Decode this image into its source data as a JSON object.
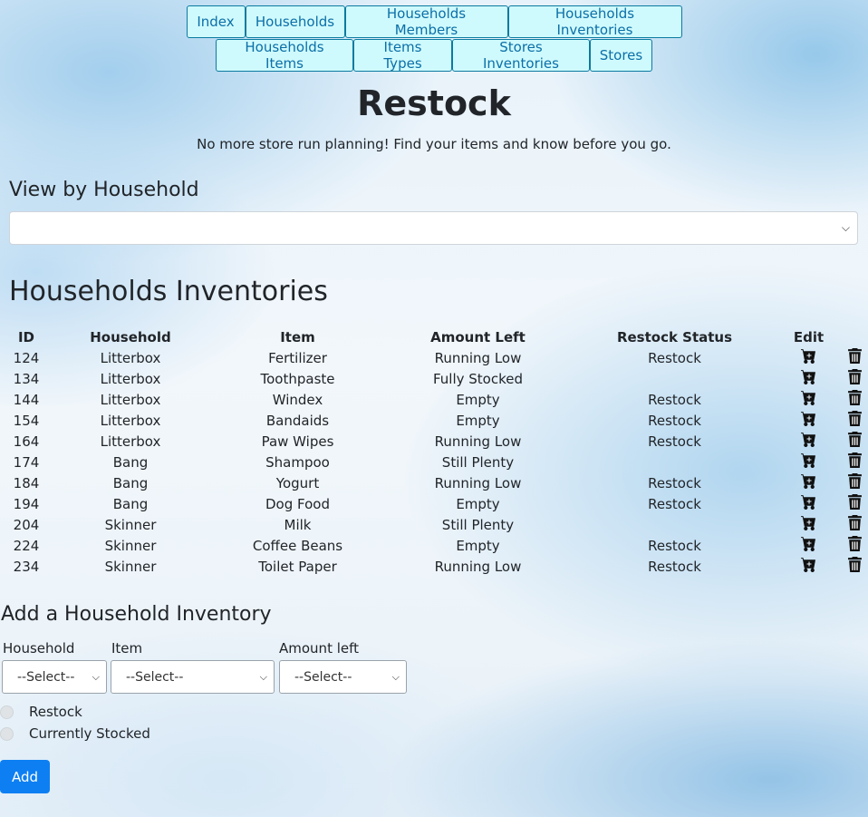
{
  "nav": {
    "row1": [
      "Index",
      "Households",
      "Households Members",
      "Households Inventories"
    ],
    "row2": [
      "Households Items",
      "Items Types",
      "Stores Inventories",
      "Stores"
    ]
  },
  "header": {
    "title": "Restock",
    "subtitle": "No more store run planning! Find your items and know before you go."
  },
  "view": {
    "label": "View by Household",
    "selected": ""
  },
  "inventory": {
    "heading": "Households Inventories",
    "columns": [
      "ID",
      "Household",
      "Item",
      "Amount Left",
      "Restock Status",
      "Edit"
    ],
    "rows": [
      [
        "124",
        "Litterbox",
        "Fertilizer",
        "Running Low",
        "Restock"
      ],
      [
        "134",
        "Litterbox",
        "Toothpaste",
        "Fully Stocked",
        ""
      ],
      [
        "144",
        "Litterbox",
        "Windex",
        "Empty",
        "Restock"
      ],
      [
        "154",
        "Litterbox",
        "Bandaids",
        "Empty",
        "Restock"
      ],
      [
        "164",
        "Litterbox",
        "Paw Wipes",
        "Running Low",
        "Restock"
      ],
      [
        "174",
        "Bang",
        "Shampoo",
        "Still Plenty",
        ""
      ],
      [
        "184",
        "Bang",
        "Yogurt",
        "Running Low",
        "Restock"
      ],
      [
        "194",
        "Bang",
        "Dog Food",
        "Empty",
        "Restock"
      ],
      [
        "204",
        "Skinner",
        "Milk",
        "Still Plenty",
        ""
      ],
      [
        "224",
        "Skinner",
        "Coffee Beans",
        "Empty",
        "Restock"
      ],
      [
        "234",
        "Skinner",
        "Toilet Paper",
        "Running Low",
        "Restock"
      ]
    ],
    "edit_icon": "cart-plus-icon",
    "delete_icon": "trash-icon"
  },
  "add_form": {
    "heading": "Add a Household Inventory",
    "household_label": "Household",
    "household_value": "--Select--",
    "item_label": "Item",
    "item_value": "--Select--",
    "amount_label": "Amount left",
    "amount_value": "--Select--",
    "radio_restock": "Restock",
    "radio_stocked": "Currently Stocked",
    "submit_label": "Add"
  },
  "colors": {
    "nav_bg": "#cffafd",
    "nav_border": "#0b7aa0",
    "primary_button": "#0d7ff3"
  }
}
